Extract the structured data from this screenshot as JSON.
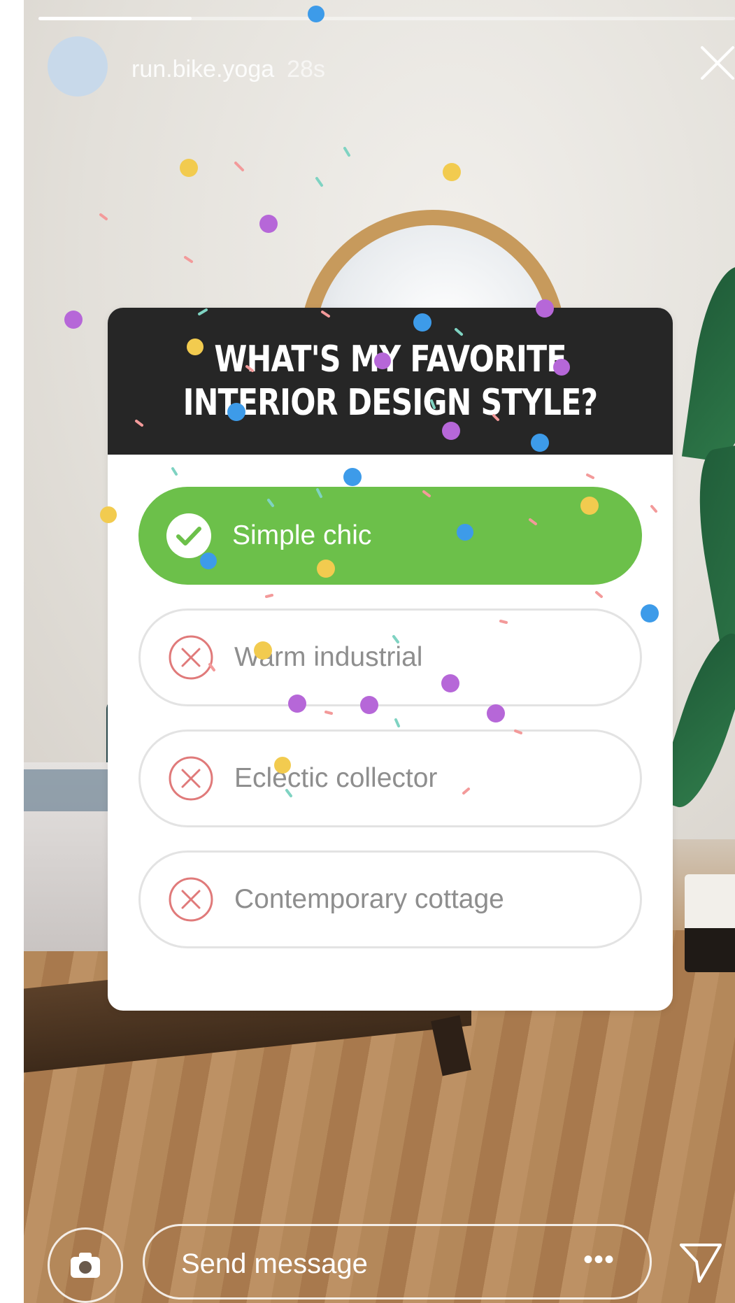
{
  "story": {
    "username": "run.bike.yoga",
    "time_ago": "28s",
    "progress": 0.22
  },
  "poll": {
    "question": "What's my favorite interior design style?",
    "options": [
      {
        "label": "Simple chic",
        "state": "correct"
      },
      {
        "label": "Warm industrial",
        "state": "incorrect"
      },
      {
        "label": "Eclectic collector",
        "state": "incorrect"
      },
      {
        "label": "Contemporary cottage",
        "state": "incorrect"
      }
    ]
  },
  "bottom_bar": {
    "message_placeholder": "Send message",
    "more_label": "•••"
  },
  "colors": {
    "correct": "#6cc04a",
    "incorrect_icon": "#e07a7a",
    "card_header": "#262626"
  }
}
